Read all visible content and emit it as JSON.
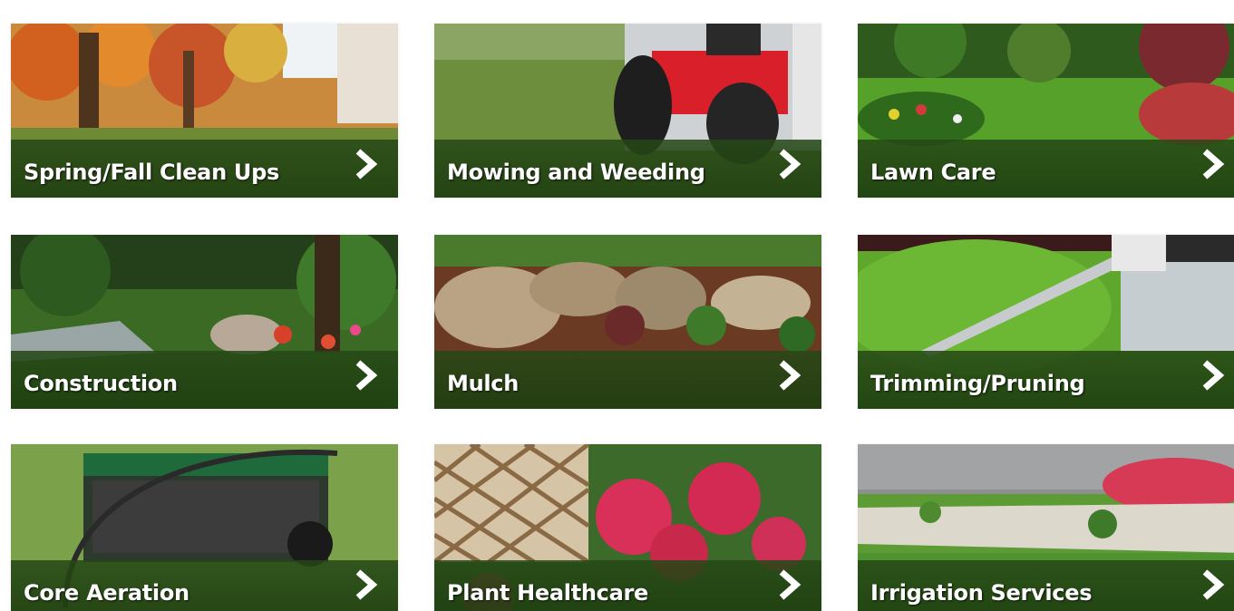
{
  "services": [
    {
      "label": "Spring/Fall Clean Ups",
      "icon": "chevron-right-icon"
    },
    {
      "label": "Mowing and Weeding",
      "icon": "chevron-right-icon"
    },
    {
      "label": "Lawn Care",
      "icon": "chevron-right-icon"
    },
    {
      "label": "Construction",
      "icon": "chevron-right-icon"
    },
    {
      "label": "Mulch",
      "icon": "chevron-right-icon"
    },
    {
      "label": "Trimming/Pruning",
      "icon": "chevron-right-icon"
    },
    {
      "label": "Core Aeration",
      "icon": "chevron-right-icon"
    },
    {
      "label": "Plant Healthcare",
      "icon": "chevron-right-icon"
    },
    {
      "label": "Irrigation Services",
      "icon": "chevron-right-icon"
    }
  ],
  "colors": {
    "bar": "#2a4d18",
    "text": "#ffffff"
  }
}
